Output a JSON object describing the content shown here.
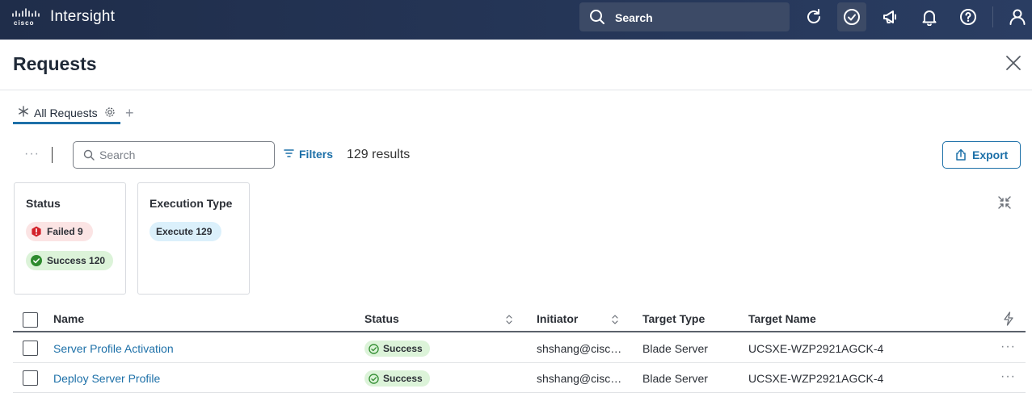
{
  "topbar": {
    "app_name": "Intersight",
    "logo_text": "cisco",
    "search_label": "Search",
    "icons": [
      "refresh-icon",
      "requests-check-icon",
      "announcement-icon",
      "notifications-bell-icon",
      "help-icon",
      "user-icon"
    ]
  },
  "page": {
    "title": "Requests"
  },
  "tabs": [
    {
      "label": "All Requests"
    }
  ],
  "toolbar": {
    "search_placeholder": "Search",
    "filters_label": "Filters",
    "results_text": "129 results",
    "export_label": "Export"
  },
  "summary_cards": {
    "status": {
      "title": "Status",
      "pills": [
        {
          "label": "Failed 9"
        },
        {
          "label": "Success 120"
        }
      ]
    },
    "execution_type": {
      "title": "Execution Type",
      "pills": [
        {
          "label": "Execute 129"
        }
      ]
    }
  },
  "table": {
    "columns": [
      "Name",
      "Status",
      "Initiator",
      "Target Type",
      "Target Name"
    ],
    "rows": [
      {
        "name": "Server Profile Activation",
        "status": "Success",
        "initiator": "shshang@cisco.com",
        "target_type": "Blade Server",
        "target_name": "UCSXE-WZP2921AGCK-4"
      },
      {
        "name": "Deploy Server Profile",
        "status": "Success",
        "initiator": "shshang@cisco.com",
        "target_type": "Blade Server",
        "target_name": "UCSXE-WZP2921AGCK-4"
      }
    ]
  },
  "colors": {
    "topbar": "#1f2d4a",
    "accent": "#1d70a8",
    "success": "#2e8b2e",
    "failed": "#d3222a"
  }
}
